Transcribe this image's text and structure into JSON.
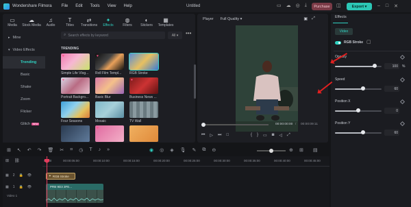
{
  "app": {
    "name": "Wondershare Filmora",
    "menu": [
      "File",
      "Edit",
      "Tools",
      "View",
      "Help"
    ],
    "title": "Untitled",
    "purchase": "Purchase",
    "export": "Export",
    "export_caret": "▾"
  },
  "tabs": [
    {
      "label": "Media",
      "icon": "folder-icon",
      "glyph": "▭"
    },
    {
      "label": "Stock Media",
      "icon": "cloud-icon",
      "glyph": "☁"
    },
    {
      "label": "Audio",
      "icon": "music-icon",
      "glyph": "♫"
    },
    {
      "label": "Titles",
      "icon": "text-icon",
      "glyph": "T"
    },
    {
      "label": "Transitions",
      "icon": "transition-icon",
      "glyph": "⇄"
    },
    {
      "label": "Effects",
      "icon": "effects-icon",
      "glyph": "✦"
    },
    {
      "label": "Filters",
      "icon": "filter-icon",
      "glyph": "◍"
    },
    {
      "label": "Stickers",
      "icon": "sticker-icon",
      "glyph": "◐"
    },
    {
      "label": "Templates",
      "icon": "template-icon",
      "glyph": "▦"
    }
  ],
  "sidebar": {
    "mine": "Mine",
    "video_effects": "Video Effects",
    "items": [
      "Trending",
      "Basic",
      "Shake",
      "Zoom",
      "Flicker",
      "Glitch"
    ],
    "new_badge": "NEW"
  },
  "search": {
    "placeholder": "Search effects by keyword",
    "filter": "All",
    "filter_caret": "▾",
    "more": "•••"
  },
  "section": "TRENDING",
  "effects": [
    {
      "label": "Simple Life Vlog...",
      "bg": "linear-gradient(135deg,#f07ab0,#f6b7d3 45%,#c9e36b)",
      "heart": true
    },
    {
      "label": "Roll Film Templ...",
      "bg": "linear-gradient(135deg,#111,#444 40%,#e9a15a 60%,#111)",
      "heart": true
    },
    {
      "label": "RGB Stroke",
      "bg": "linear-gradient(135deg,#5b8fd6,#e8c060 50%,#3a7bd5)",
      "heart": false,
      "selected": true
    },
    {
      "label": "Portrait Backgro...",
      "bg": "linear-gradient(135deg,#d9d9e8,#b96c84 50%,#e7c2cf)",
      "heart": true
    },
    {
      "label": "Basic Blur",
      "bg": "linear-gradient(135deg,#d87aa8,#f4c08a 50%,#9a63b6)",
      "heart": false
    },
    {
      "label": "Business News ...",
      "bg": "linear-gradient(135deg,#7b1a1a,#c33 50%,#5e1212)",
      "heart": true
    },
    {
      "label": "Four Seasons",
      "bg": "linear-gradient(135deg,#3fa0d8,#8ed0ee 40%,#e4c35f 70%,#d97a3a)",
      "heart": false
    },
    {
      "label": "Mosaic",
      "bg": "linear-gradient(135deg,#7fb8c9,#a7d0d9 50%,#5b8fa3)",
      "heart": false
    },
    {
      "label": "TV Wall",
      "bg": "repeating-linear-gradient(90deg,#6a7a80 0 5px,#8a9aa0 5px 10px)",
      "heart": false
    },
    {
      "label": "",
      "bg": "linear-gradient(135deg,#2a3a50,#5f7a9a)",
      "heart": false
    },
    {
      "label": "",
      "bg": "linear-gradient(135deg,#e06aa0,#f3b0c8)",
      "heart": true
    },
    {
      "label": "",
      "bg": "linear-gradient(135deg,#f0b060,#e08a3a)",
      "heart": false
    }
  ],
  "player": {
    "label": "Player",
    "quality": "Full Quality",
    "quality_caret": "▾",
    "time_current": "00:00:00:00",
    "time_separator": "/",
    "time_total": "00:00:09:11",
    "progress": 0.0
  },
  "props": {
    "tab": "Effects",
    "chip": "Video",
    "effect_name": "RGB Stroke",
    "params": [
      {
        "label": "Opacity",
        "value": "100",
        "unit": "%",
        "level": 0.85
      },
      {
        "label": "Speed",
        "value": "60",
        "unit": "",
        "level": 0.6
      },
      {
        "label": "Position X",
        "value": "0",
        "unit": "",
        "level": 0.5
      },
      {
        "label": "Position Y",
        "value": "60",
        "unit": "",
        "level": 0.6
      }
    ]
  },
  "timeline": {
    "ruler": [
      "00:00",
      "00:00:05:00",
      "00:00:10:00",
      "00:00:15:00",
      "00:00:20:00",
      "00:00:25:00",
      "00:00:30:00",
      "00:00:35:00",
      "00:00:40:00",
      "00:00:45:00"
    ],
    "track_effect_num": "2",
    "track_video_num": "1",
    "track_video_name": "Video 1",
    "clip_effect": "RGB Stroke",
    "clip_video": "PRB 9D3 3FE..."
  },
  "colors": {
    "accent": "#2fd3c3",
    "annotation_arrow": "#e02020"
  }
}
